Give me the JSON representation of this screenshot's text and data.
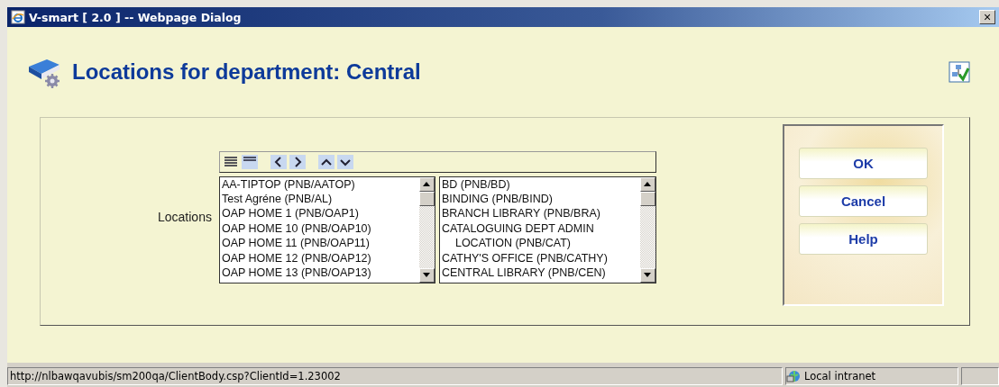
{
  "window": {
    "title": "V-smart [ 2.0 ] -- Webpage Dialog",
    "close": "×"
  },
  "heading": "Locations for department: Central",
  "field": {
    "label": "Locations",
    "available": [
      "AA-TIPTOP (PNB/AATOP)",
      "Test Agréne (PNB/AL)",
      "OAP HOME 1 (PNB/OAP1)",
      "OAP HOME 10 (PNB/OAP10)",
      "OAP HOME 11 (PNB/OAP11)",
      "OAP HOME 12 (PNB/OAP12)",
      "OAP HOME 13 (PNB/OAP13)"
    ],
    "chosen": [
      "BD (PNB/BD)",
      "BINDING (PNB/BIND)",
      "BRANCH LIBRARY (PNB/BRA)",
      "CATALOGUING DEPT ADMIN LOCATION (PNB/CAT)",
      "CATHY'S OFFICE (PNB/CATHY)",
      "CENTRAL LIBRARY (PNB/CEN)"
    ]
  },
  "buttons": [
    "OK",
    "Cancel",
    "Help"
  ],
  "status_bar": {
    "url": "http://nlbawqavubis/sm200qa/ClientBody.csp?ClientId=1.23002",
    "zone": "Local intranet"
  }
}
